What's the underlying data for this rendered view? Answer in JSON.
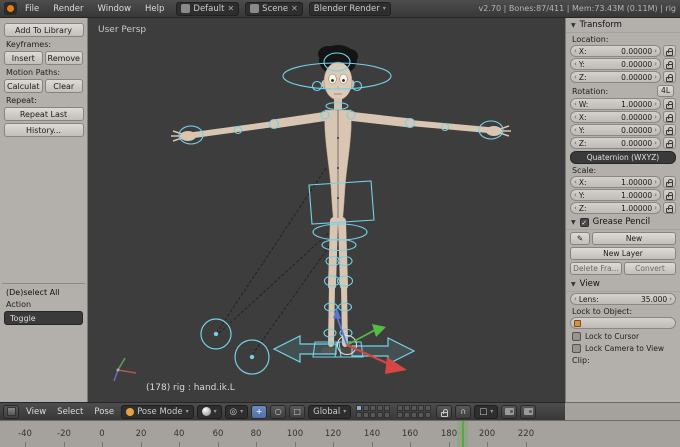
{
  "topbar": {
    "menus": [
      "File",
      "Render",
      "Window",
      "Help"
    ],
    "layout_value": "Default",
    "scene_value": "Scene",
    "engine_value": "Blender Render",
    "stats": "v2.70 | Bones:87/411 | Mem:73.43M (0.11M) | rig"
  },
  "toolshelf": {
    "add_to_library": "Add To Library",
    "keyframes_label": "Keyframes:",
    "insert": "Insert",
    "remove": "Remove",
    "motion_paths_label": "Motion Paths:",
    "calculate": "Calculat",
    "clear": "Clear",
    "repeat_label": "Repeat:",
    "repeat_last": "Repeat Last",
    "history": "History...",
    "deselect_all": "(De)select All",
    "action_label": "Action",
    "toggle_value": "Toggle"
  },
  "viewport": {
    "view_label": "User Persp",
    "active_bone": "(178) rig : hand.ik.L"
  },
  "properties": {
    "transform": {
      "title": "Transform",
      "location_label": "Location:",
      "location": [
        {
          "label": "X:",
          "value": "0.00000"
        },
        {
          "label": "Y:",
          "value": "0.00000"
        },
        {
          "label": "Z:",
          "value": "0.00000"
        }
      ],
      "rotation_label": "Rotation:",
      "rotation_lock_mode": "4L",
      "rotation": [
        {
          "label": "W:",
          "value": "1.00000"
        },
        {
          "label": "X:",
          "value": "0.00000"
        },
        {
          "label": "Y:",
          "value": "0.00000"
        },
        {
          "label": "Z:",
          "value": "0.00000"
        }
      ],
      "rotation_mode": "Quaternion (WXYZ)",
      "scale_label": "Scale:",
      "scale": [
        {
          "label": "X:",
          "value": "1.00000"
        },
        {
          "label": "Y:",
          "value": "1.00000"
        },
        {
          "label": "Z:",
          "value": "1.00000"
        }
      ]
    },
    "grease_pencil": {
      "title": "Grease Pencil",
      "new_button": "New",
      "new_layer_button": "New Layer",
      "delete_frame_button": "Delete Fra...",
      "convert_button": "Convert"
    },
    "view": {
      "title": "View",
      "lens_label": "Lens:",
      "lens_value": "35.000",
      "lock_to_object_label": "Lock to Object:",
      "lock_to_cursor": "Lock to Cursor",
      "lock_camera_to_view": "Lock Camera to View",
      "clip_label": "Clip:"
    }
  },
  "viewport_header": {
    "menus": [
      "View",
      "Select",
      "Pose"
    ],
    "mode": "Pose Mode",
    "orientation": "Global"
  },
  "timeline": {
    "ticks": [
      "-40",
      "-20",
      "0",
      "20",
      "40",
      "60",
      "80",
      "100",
      "120",
      "140",
      "160",
      "180",
      "200",
      "220"
    ]
  },
  "icons": {
    "collapse": "▼",
    "dropdown": "▾",
    "pencil": "✎",
    "check": "✓",
    "inc_left": "‹",
    "inc_right": "›",
    "close": "✕",
    "translate": "+",
    "rotate": "○",
    "scale": "□",
    "pivot": "◎",
    "magnet": "∩",
    "cube": "□"
  }
}
